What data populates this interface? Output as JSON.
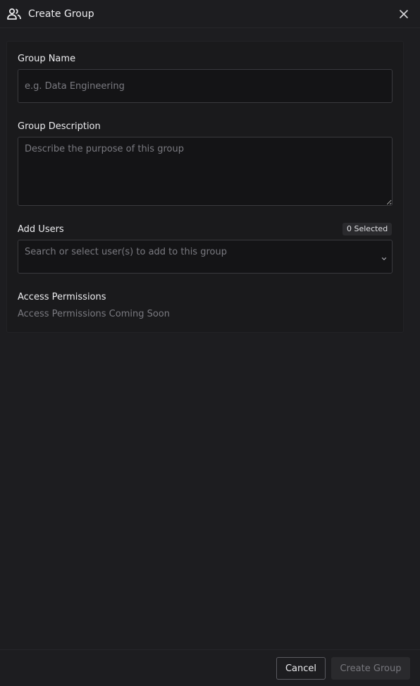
{
  "header": {
    "title": "Create Group",
    "icon": "users-icon",
    "close_icon": "close-icon"
  },
  "form": {
    "group_name": {
      "label": "Group Name",
      "value": "",
      "placeholder": "e.g. Data Engineering"
    },
    "group_description": {
      "label": "Group Description",
      "value": "",
      "placeholder": "Describe the purpose of this group"
    },
    "add_users": {
      "label": "Add Users",
      "selected_badge": "0 Selected",
      "placeholder": "Search or select user(s) to add to this group",
      "chevron_icon": "chevron-down-icon"
    },
    "access_permissions": {
      "label": "Access Permissions",
      "note": "Access Permissions Coming Soon"
    }
  },
  "footer": {
    "cancel_label": "Cancel",
    "create_label": "Create Group"
  },
  "colors": {
    "background": "#1d1d20",
    "card": "#1a1a1c",
    "field": "#141416",
    "border": "#3a3a3e",
    "muted_text": "#7a7a80",
    "disabled_button": "#2a2a2d"
  }
}
